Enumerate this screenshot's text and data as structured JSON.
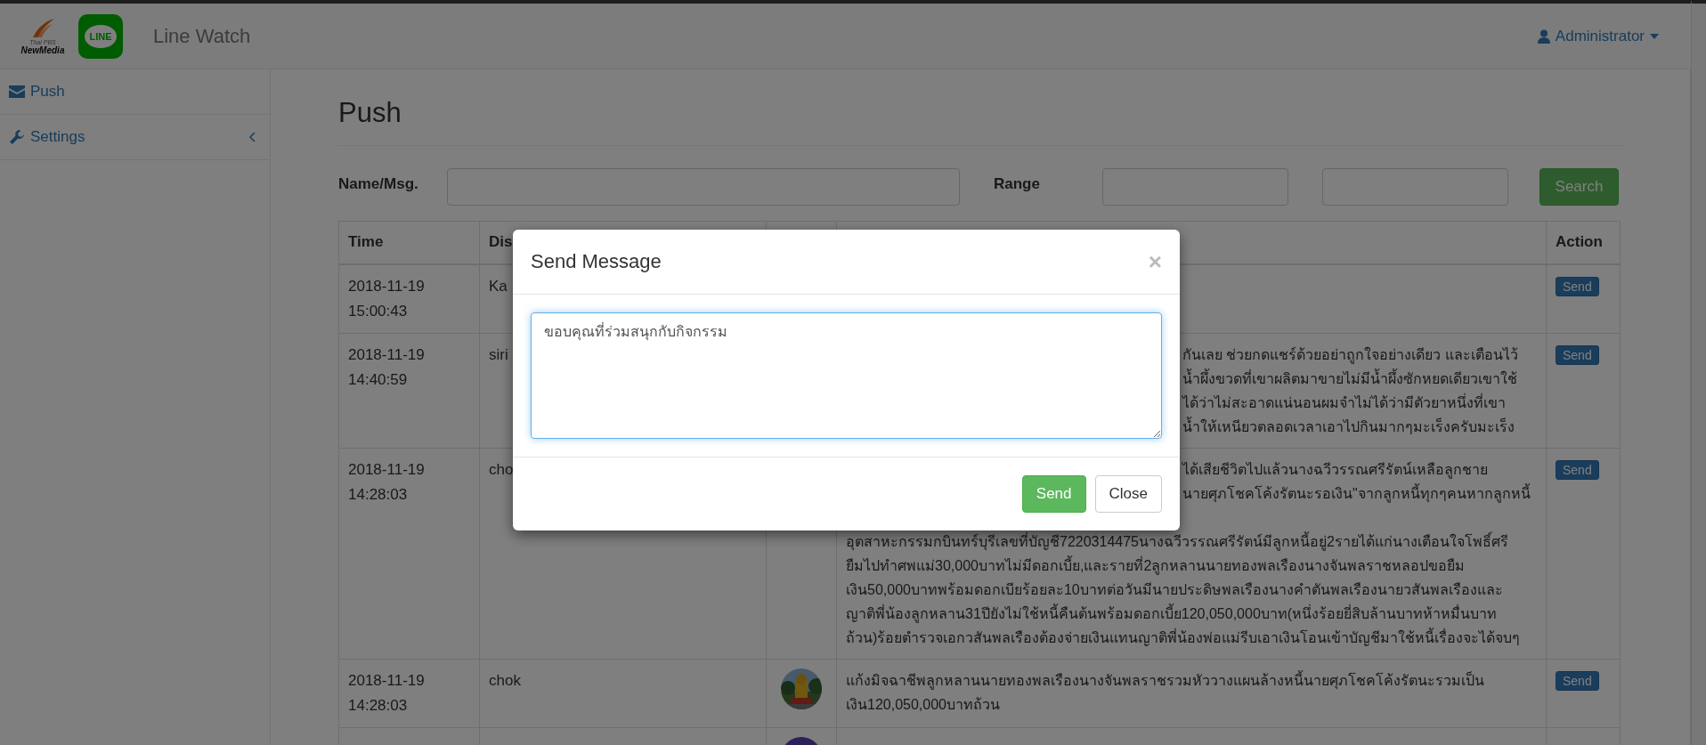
{
  "header": {
    "logo_text": [
      "Thai PBS",
      "NewMedia"
    ],
    "app_icon_text": "LINE",
    "title": "Line Watch",
    "user": "Administrator"
  },
  "sidebar": {
    "items": [
      {
        "label": "Push",
        "kind": "envelope",
        "expandable": false
      },
      {
        "label": "Settings",
        "kind": "wrench",
        "expandable": true
      }
    ]
  },
  "page": {
    "title": "Push",
    "filters": {
      "name_label": "Name/Msg.",
      "range_label": "Range",
      "search_button": "Search"
    }
  },
  "table": {
    "columns": [
      {
        "kind": "text",
        "label": "Time"
      },
      {
        "kind": "text",
        "label": "Dis"
      },
      {
        "kind": "blank"
      },
      {
        "kind": "blank"
      },
      {
        "kind": "text",
        "label": "Action"
      }
    ],
    "rows": [
      {
        "time": "2018-11-19 15:00:43",
        "name": "Ka",
        "action": "Send"
      },
      {
        "time": "2018-11-19 14:40:59",
        "name": "siri",
        "action": "Send",
        "message": {
          "clipped": [
            "กันเลย ช่วยกดแชร์ด้วยอย่าถูกใจอย่างเดียว และเตือนไว้",
            "น้ำผึ้งขวดที่เขาผลิตมาขายไม่มีน้ำผึ้งซักหยดเดียวเขาใช้",
            "ได้ว่าไม่สะอาดแน่นอนผมจำไม่ได้ว่ามีตัวยาหนึ่งที่เขา",
            "น้ำให้เหนียวตลอดเวลาเอาไปกินมากๆมะเร็งครับมะเร็ง"
          ]
        }
      },
      {
        "time": "2018-11-19 14:28:03",
        "name": "cho",
        "action": "Send",
        "message": {
          "clipped": [
            "ได้เสียชีวิตไปแล้วนางฉวีวรรณศรีรัตน์เหลือลูกชาย",
            "นายศุภโชคโค้งรัตนะรอเงิน\"จากลูกหนี้ทุกๆคนหากลูกหนี้"
          ],
          "lines": [
            "อุตสาหะกรรมกบินทร์บุรีเลขที่บัญชี7220314475นางฉวีวรรณศรีรัตน์มีลูกหนี้อยู่2รายได้แก่นางเตือนใจโพธิ์ศรี",
            "ยืมไปทำศพแม่30,000บาทไม่มีดอกเบี้ย,และรายที่2ลูกหลานนายทองพลเรืองนางจันพลราชหลอปขอยืม",
            "เงิน50,000บาทพร้อมดอกเบียร้อยละ10บาทต่อวันมีนายประดิษพลเรืองนางคำตันพลเรืองนายวสันพลเรืองและ",
            "ญาติพี่น้องลูกหลาน31ปียังไม่ใช้หนี้คืนต้นพร้อมดอกเบี้ย120,050,000บาท(หนึ่งร้อยยี่สิบล้านบาทห้าหมื่นบาท",
            "ถ้วน)ร้อยตำรวจเอกวสันพลเรืองต้องจ่ายเงินแทนญาติพี่น้องพ่อแม่รีบเอาเงินโอนเข้าบัญชีมาใช้หนี้เรื่องจะได้จบๆ"
          ]
        }
      },
      {
        "time": "2018-11-19 14:28:03",
        "name": "chok",
        "action": "Send",
        "avatar": {
          "kind": "picture"
        },
        "message": {
          "text": "แก้งมิจฉาชีพลูกหลานนายทองพลเรืองนางจันพลราชรวมหัววางแผนล้างหนี้นายศุภโชคโค้งรัตนะรวมเป็นเงิน120,050,000บาทถ้วน"
        }
      },
      {
        "avatar": {
          "kind": "picture"
        }
      }
    ]
  },
  "dialog": {
    "title": "Send Message",
    "close": "×",
    "message": "ขอบคุณที่ร่วมสนุกกับกิจกรรม",
    "buttons": [
      {
        "label": "Send",
        "kind": "primary"
      },
      {
        "label": "Close",
        "kind": "default"
      }
    ]
  }
}
